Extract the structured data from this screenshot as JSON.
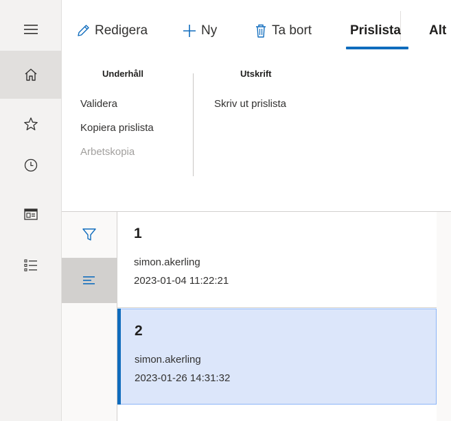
{
  "nav": {
    "items": [
      {
        "icon": "hamburger-icon"
      },
      {
        "icon": "home-icon"
      },
      {
        "icon": "star-icon"
      },
      {
        "icon": "clock-icon"
      },
      {
        "icon": "workspace-icon"
      },
      {
        "icon": "list-icon"
      }
    ]
  },
  "commandbar": {
    "edit_label": "Redigera",
    "new_label": "Ny",
    "delete_label": "Ta bort",
    "tab_pricelist": "Prislista",
    "tab_more": "Alt"
  },
  "ribbon": {
    "group1": {
      "title": "Underhåll",
      "items": [
        "Validera",
        "Kopiera prislista",
        "Arbetskopia"
      ]
    },
    "group2": {
      "title": "Utskrift",
      "items": [
        "Skriv ut prislista"
      ]
    }
  },
  "list": {
    "records": [
      {
        "title": "1",
        "user": "simon.akerling",
        "date": "2023-01-04 11:22:21",
        "selected": false
      },
      {
        "title": "2",
        "user": "simon.akerling",
        "date": "2023-01-26 14:31:32",
        "selected": true
      }
    ]
  },
  "colors": {
    "accent": "#0f6cbd",
    "selected_bg": "#dce6fa",
    "nav_bg": "#f3f2f1"
  }
}
